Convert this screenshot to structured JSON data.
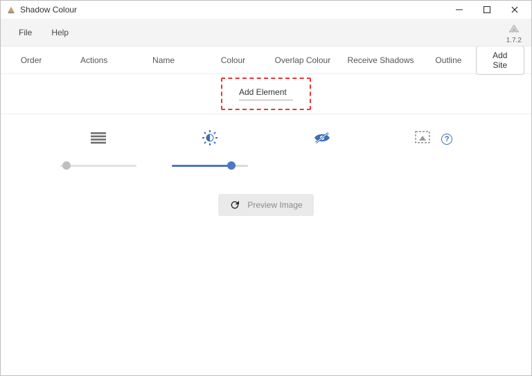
{
  "window": {
    "title": "Shadow Colour"
  },
  "menubar": {
    "file": "File",
    "help": "Help",
    "version": "1.7.2"
  },
  "columns": {
    "order": "Order",
    "actions": "Actions",
    "name": "Name",
    "colour": "Colour",
    "overlap": "Overlap Colour",
    "receive": "Receive Shadows",
    "outline": "Outline",
    "add_site": "Add Site"
  },
  "add_element": {
    "label": "Add Element"
  },
  "icons": {
    "lines": "lines-icon",
    "brightness": "brightness-icon",
    "hidden": "eye-off-icon",
    "marquee": "marquee-select-icon",
    "help": "?"
  },
  "sliders": {
    "opacity_value": 8,
    "brightness_value": 78
  },
  "preview": {
    "label": "Preview Image"
  }
}
